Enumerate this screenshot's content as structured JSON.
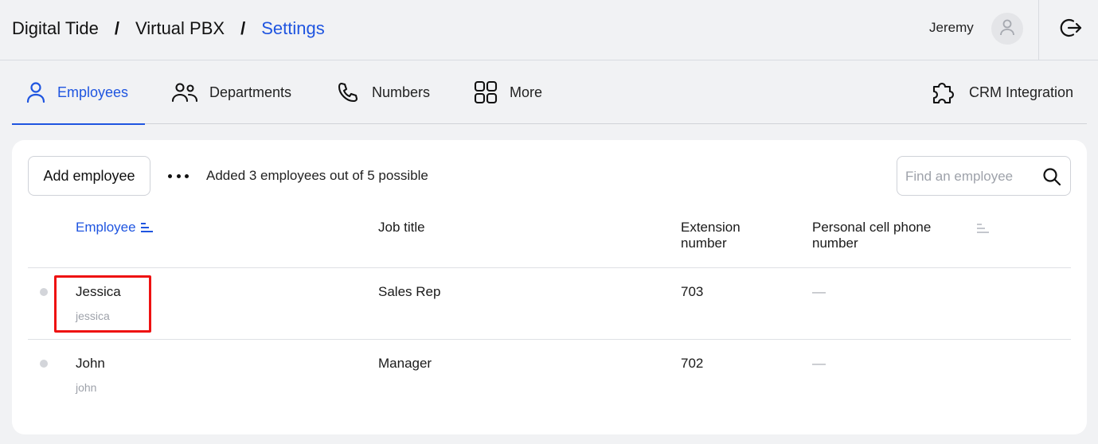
{
  "breadcrumb": {
    "items": [
      "Digital Tide",
      "Virtual PBX",
      "Settings"
    ],
    "separator": "/"
  },
  "header": {
    "user_name": "Jeremy",
    "avatar_icon": "user-icon",
    "logout_icon": "logout-icon"
  },
  "tabs": [
    {
      "label": "Employees",
      "icon": "person-icon",
      "active": true
    },
    {
      "label": "Departments",
      "icon": "people-icon",
      "active": false
    },
    {
      "label": "Numbers",
      "icon": "phone-icon",
      "active": false
    },
    {
      "label": "More",
      "icon": "grid-icon",
      "active": false
    },
    {
      "label": "CRM Integration",
      "icon": "puzzle-icon",
      "active": false
    }
  ],
  "toolbar": {
    "add_label": "Add employee",
    "info": "Added 3 employees out of 5 possible",
    "search_placeholder": "Find an employee"
  },
  "table": {
    "headers": {
      "employee": "Employee",
      "job_title": "Job title",
      "extension_line1": "Extension",
      "extension_line2": "number",
      "phone_line1": "Personal cell phone",
      "phone_line2": "number"
    },
    "rows": [
      {
        "name": "Jessica",
        "login": "jessica",
        "job_title": "Sales Rep",
        "extension": "703",
        "phone": "—",
        "highlighted": true
      },
      {
        "name": "John",
        "login": "john",
        "job_title": "Manager",
        "extension": "702",
        "phone": "—",
        "highlighted": false
      }
    ]
  },
  "colors": {
    "accent": "#1f55e0",
    "highlight": "#ee1111",
    "background": "#f1f2f4"
  }
}
